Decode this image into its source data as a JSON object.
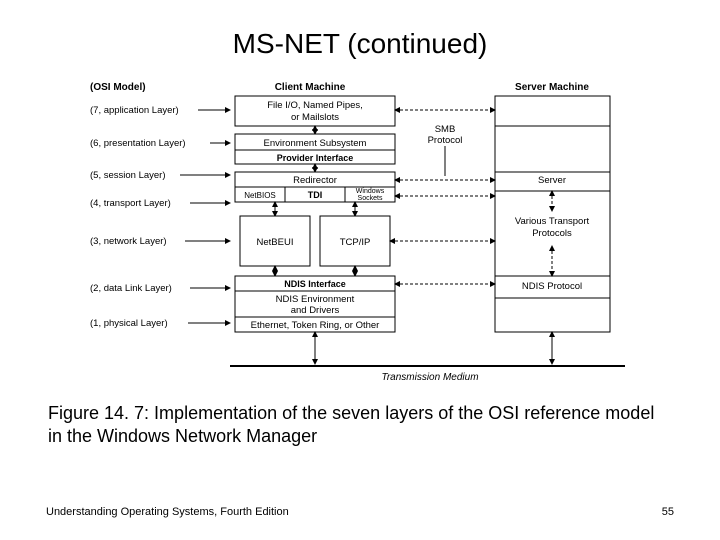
{
  "title": "MS-NET (continued)",
  "caption": "Figure 14. 7: Implementation of the seven layers of the OSI reference model in the Windows Network Manager",
  "footer_left": "Understanding Operating Systems, Fourth Edition",
  "footer_right": "55",
  "diagram": {
    "osi_header": "(OSI Model)",
    "client_header": "Client Machine",
    "server_header": "Server Machine",
    "layers": [
      "(7, application Layer)",
      "(6, presentation Layer)",
      "(5, session Layer)",
      "(4, transport Layer)",
      "(3, network Layer)",
      "(2, data Link Layer)",
      "(1, physical Layer)"
    ],
    "client_blocks": {
      "file_io": [
        "File I/O, Named Pipes,",
        "or Mailslots"
      ],
      "env_sub": "Environment Subsystem",
      "provider_if": "Provider Interface",
      "redirector": "Redirector",
      "tdi": "TDI",
      "netbios": "NetBIOS",
      "winsock": [
        "Windows",
        "Sockets"
      ],
      "netbeui": "NetBEUI",
      "tcpip": "TCP/IP",
      "ndis_if": "NDIS Interface",
      "ndis_env": [
        "NDIS Environment",
        "and Drivers"
      ],
      "ethernet": "Ethernet, Token Ring, or Other"
    },
    "server_blocks": {
      "smb": [
        "SMB",
        "Protocol"
      ],
      "server_box": "Server",
      "transport": [
        "Various Transport",
        "Protocols"
      ],
      "ndis": "NDIS Protocol"
    },
    "transmission": "Transmission Medium"
  }
}
